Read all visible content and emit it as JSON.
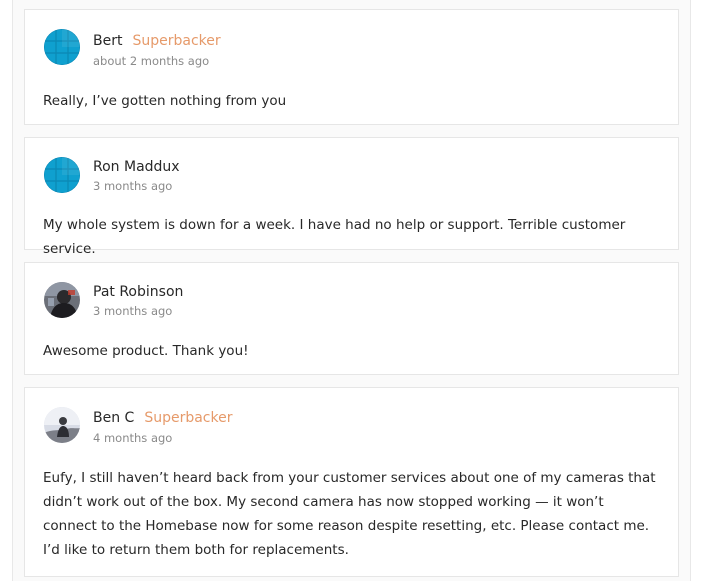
{
  "comments": [
    {
      "author": "Bert",
      "badge": "Superbacker",
      "time": "about 2 months ago",
      "text": "Really, I’ve gotten nothing from you",
      "avatar_icon": "default-globe-avatar"
    },
    {
      "author": "Ron Maddux",
      "badge": "",
      "time": "3 months ago",
      "text": "My whole system is down for a week. I have had no help or support. Terrible customer service.",
      "avatar_icon": "default-globe-avatar"
    },
    {
      "author": "Pat Robinson",
      "badge": "",
      "time": "3 months ago",
      "text": "Awesome product. Thank you!",
      "avatar_icon": "user-photo-avatar"
    },
    {
      "author": "Ben C",
      "badge": "Superbacker",
      "time": "4 months ago",
      "text": "Eufy, I still haven’t heard back from your customer services about one of my cameras that didn’t work out of the box. My second camera has now stopped working — it won’t connect to the Homebase now for some reason despite resetting, etc. Please contact me. I’d like to return them both for replacements.",
      "avatar_icon": "user-photo-avatar"
    }
  ],
  "colors": {
    "badge": "#e69a6a",
    "text": "#282828",
    "muted": "#8a8a8a",
    "avatar_blue": "#0fa0cf"
  }
}
